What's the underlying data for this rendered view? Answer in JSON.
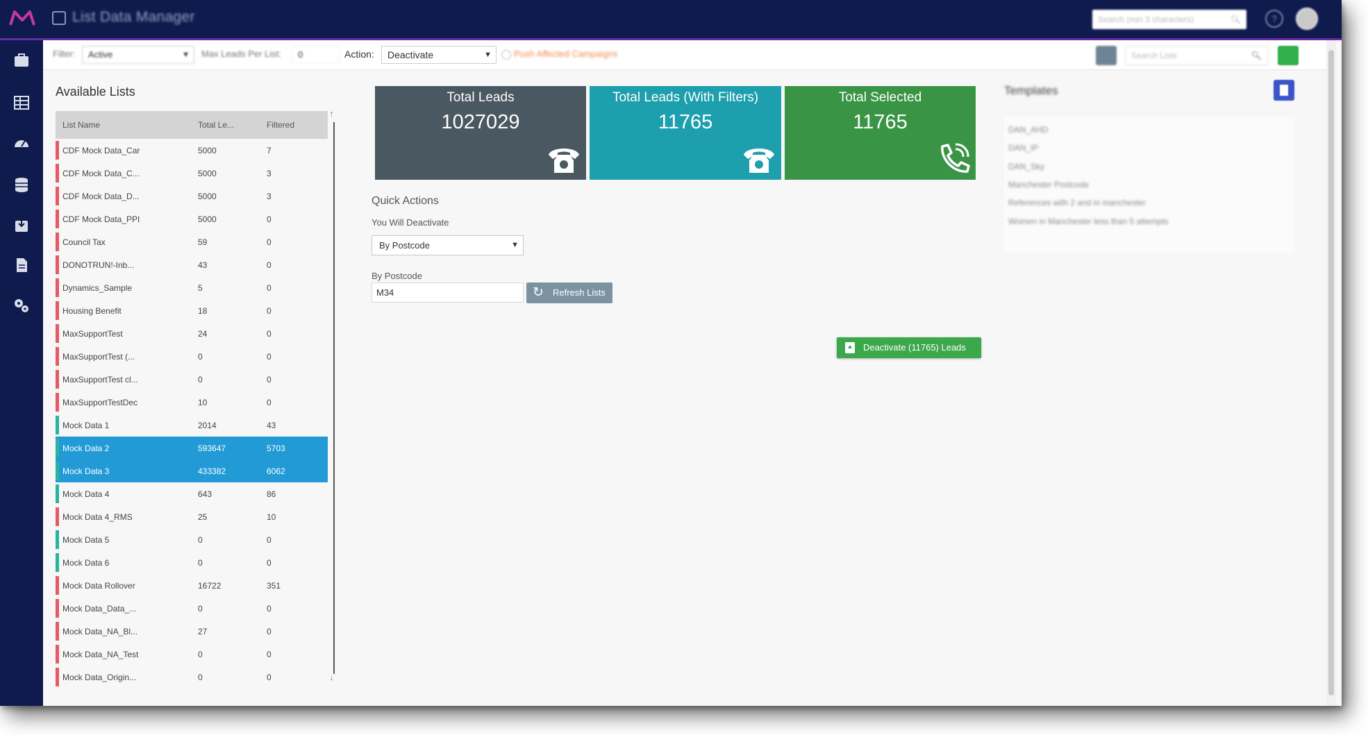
{
  "header": {
    "app_title": "List Data Manager",
    "search_placeholder": "Search (min 3 characters)"
  },
  "toolbar": {
    "filter_label": "Filter:",
    "filter_value": "Active",
    "max_leads_label": "Max Leads Per List:",
    "max_leads_value": "0",
    "action_label": "Action:",
    "action_value": "Deactivate",
    "push_label": "Push Affected Campaigns",
    "search_lists_placeholder": "Search Lists"
  },
  "available_lists": {
    "title": "Available Lists",
    "columns": [
      "List Name",
      "Total Le...",
      "Filtered"
    ],
    "rows": [
      {
        "name": "CDF Mock Data_Car",
        "total": "5000",
        "filtered": "7",
        "status": "inactive",
        "selected": false
      },
      {
        "name": "CDF Mock Data_C...",
        "total": "5000",
        "filtered": "3",
        "status": "inactive",
        "selected": false
      },
      {
        "name": "CDF Mock Data_D...",
        "total": "5000",
        "filtered": "3",
        "status": "inactive",
        "selected": false
      },
      {
        "name": "CDF Mock Data_PPI",
        "total": "5000",
        "filtered": "0",
        "status": "inactive",
        "selected": false
      },
      {
        "name": "Council Tax",
        "total": "59",
        "filtered": "0",
        "status": "inactive",
        "selected": false
      },
      {
        "name": "DONOTRUN!-Inb...",
        "total": "43",
        "filtered": "0",
        "status": "inactive",
        "selected": false
      },
      {
        "name": "Dynamics_Sample",
        "total": "5",
        "filtered": "0",
        "status": "inactive",
        "selected": false
      },
      {
        "name": "Housing Benefit",
        "total": "18",
        "filtered": "0",
        "status": "inactive",
        "selected": false
      },
      {
        "name": "MaxSupportTest",
        "total": "24",
        "filtered": "0",
        "status": "inactive",
        "selected": false
      },
      {
        "name": "MaxSupportTest (...",
        "total": "0",
        "filtered": "0",
        "status": "inactive",
        "selected": false
      },
      {
        "name": "MaxSupportTest cl...",
        "total": "0",
        "filtered": "0",
        "status": "inactive",
        "selected": false
      },
      {
        "name": "MaxSupportTestDec",
        "total": "10",
        "filtered": "0",
        "status": "inactive",
        "selected": false
      },
      {
        "name": "Mock Data 1",
        "total": "2014",
        "filtered": "43",
        "status": "active",
        "selected": false
      },
      {
        "name": "Mock Data 2",
        "total": "593647",
        "filtered": "5703",
        "status": "active",
        "selected": true
      },
      {
        "name": "Mock Data 3",
        "total": "433382",
        "filtered": "6062",
        "status": "active",
        "selected": true
      },
      {
        "name": "Mock Data 4",
        "total": "643",
        "filtered": "86",
        "status": "active",
        "selected": false
      },
      {
        "name": "Mock Data 4_RMS",
        "total": "25",
        "filtered": "10",
        "status": "inactive",
        "selected": false
      },
      {
        "name": "Mock Data 5",
        "total": "0",
        "filtered": "0",
        "status": "active",
        "selected": false
      },
      {
        "name": "Mock Data 6",
        "total": "0",
        "filtered": "0",
        "status": "active",
        "selected": false
      },
      {
        "name": "Mock Data Rollover",
        "total": "16722",
        "filtered": "351",
        "status": "inactive",
        "selected": false
      },
      {
        "name": "Mock Data_Data_...",
        "total": "0",
        "filtered": "0",
        "status": "inactive",
        "selected": false
      },
      {
        "name": "Mock Data_NA_Bl...",
        "total": "27",
        "filtered": "0",
        "status": "inactive",
        "selected": false
      },
      {
        "name": "Mock Data_NA_Test",
        "total": "0",
        "filtered": "0",
        "status": "inactive",
        "selected": false
      },
      {
        "name": "Mock Data_Origin...",
        "total": "0",
        "filtered": "0",
        "status": "inactive",
        "selected": false
      }
    ]
  },
  "stats": {
    "total_leads": {
      "label": "Total Leads",
      "value": "1027029"
    },
    "total_filtered": {
      "label": "Total Leads (With Filters)",
      "value": "11765"
    },
    "total_selected": {
      "label": "Total Selected",
      "value": "11765"
    }
  },
  "quick_actions": {
    "title": "Quick Actions",
    "subtitle": "You Will Deactivate",
    "mode_value": "By Postcode",
    "postcode_label": "By Postcode",
    "postcode_value": "M34",
    "refresh_label": "Refresh Lists",
    "deactivate_label": "Deactivate (11765) Leads"
  },
  "templates": {
    "title": "Templates",
    "items": [
      "DAN_AHD",
      "DAN_IP",
      "DAN_Sky",
      "Manchester Postcode",
      "References with 2 and in manchester",
      "Women in Manchester less than 5 attempts"
    ]
  },
  "colors": {
    "navy": "#0f1a4d",
    "accent_purple": "#6c2aa8",
    "card_total": "#4a5862",
    "card_filtered": "#1e9fae",
    "card_selected": "#3a9446",
    "selected_row": "#229ad6",
    "inactive_marker": "#e55a66",
    "active_marker": "#2ab4a0"
  }
}
